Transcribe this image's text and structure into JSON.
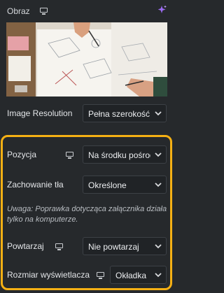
{
  "header": {
    "title": "Obraz",
    "icons": [
      "desktop-icon",
      "ai-sparkle-icon"
    ]
  },
  "fields": {
    "image_resolution": {
      "label": "Image Resolution",
      "value": "Pełna szerokość"
    },
    "position": {
      "label": "Pozycja",
      "value": "Na środku pośrodku"
    },
    "attachment": {
      "label": "Zachowanie tła",
      "value": "Określone"
    },
    "attachment_note": "Uwaga: Poprawka dotycząca załącznika działa tylko na komputerze.",
    "repeat": {
      "label": "Powtarzaj",
      "value": "Nie powtarzaj"
    },
    "display_size": {
      "label": "Rozmiar wyświetlacza",
      "value": "Okładka"
    }
  },
  "colors": {
    "panel_bg": "#26292c",
    "field_bg": "#202326",
    "highlight": "#f5b014"
  }
}
